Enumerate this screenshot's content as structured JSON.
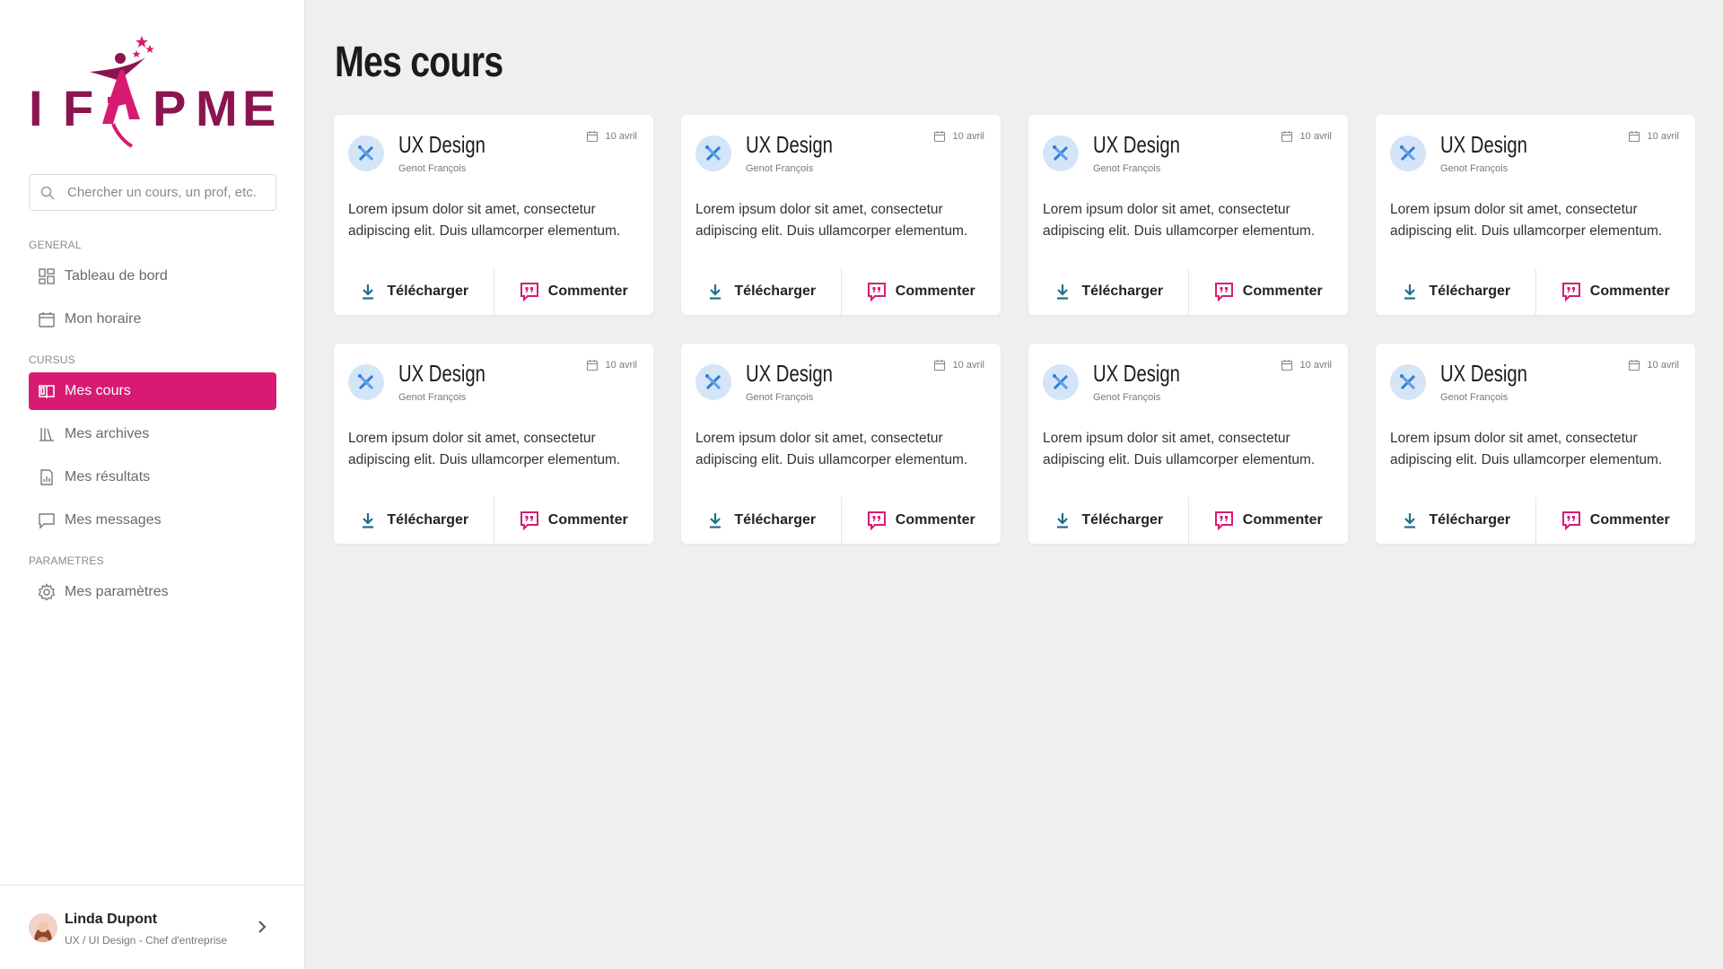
{
  "sidebar": {
    "logo_text": "IFAPME",
    "search_placeholder": "Chercher un cours, un prof, etc.",
    "sections": [
      {
        "label": "GENERAL",
        "items": [
          {
            "label": "Tableau de bord",
            "icon": "dashboard-icon"
          },
          {
            "label": "Mon horaire",
            "icon": "calendar-icon"
          }
        ]
      },
      {
        "label": "CURSUS",
        "items": [
          {
            "label": "Mes cours",
            "icon": "open-book-icon",
            "active": true
          },
          {
            "label": "Mes archives",
            "icon": "library-icon"
          },
          {
            "label": "Mes résultats",
            "icon": "report-icon"
          },
          {
            "label": "Mes messages",
            "icon": "message-icon"
          }
        ]
      },
      {
        "label": "PARAMETRES",
        "items": [
          {
            "label": "Mes paramètres",
            "icon": "gear-icon"
          }
        ]
      }
    ]
  },
  "profile": {
    "name": "Linda Dupont",
    "role": "UX / UI Design - Chef d'entreprise"
  },
  "page": {
    "title": "Mes cours"
  },
  "courses": [
    {
      "title": "UX Design",
      "author": "Genot François",
      "date": "10 avril",
      "description": "Lorem ipsum dolor sit amet, consectetur adipiscing elit. Duis ullamcorper elementum.",
      "download_label": "Télécharger",
      "comment_label": "Commenter"
    },
    {
      "title": "UX Design",
      "author": "Genot François",
      "date": "10 avril",
      "description": "Lorem ipsum dolor sit amet, consectetur adipiscing elit. Duis ullamcorper elementum.",
      "download_label": "Télécharger",
      "comment_label": "Commenter"
    },
    {
      "title": "UX Design",
      "author": "Genot François",
      "date": "10 avril",
      "description": "Lorem ipsum dolor sit amet, consectetur adipiscing elit. Duis ullamcorper elementum.",
      "download_label": "Télécharger",
      "comment_label": "Commenter"
    },
    {
      "title": "UX Design",
      "author": "Genot François",
      "date": "10 avril",
      "description": "Lorem ipsum dolor sit amet, consectetur adipiscing elit. Duis ullamcorper elementum.",
      "download_label": "Télécharger",
      "comment_label": "Commenter"
    },
    {
      "title": "UX Design",
      "author": "Genot François",
      "date": "10 avril",
      "description": "Lorem ipsum dolor sit amet, consectetur adipiscing elit. Duis ullamcorper elementum.",
      "download_label": "Télécharger",
      "comment_label": "Commenter"
    },
    {
      "title": "UX Design",
      "author": "Genot François",
      "date": "10 avril",
      "description": "Lorem ipsum dolor sit amet, consectetur adipiscing elit. Duis ullamcorper elementum.",
      "download_label": "Télécharger",
      "comment_label": "Commenter"
    },
    {
      "title": "UX Design",
      "author": "Genot François",
      "date": "10 avril",
      "description": "Lorem ipsum dolor sit amet, consectetur adipiscing elit. Duis ullamcorper elementum.",
      "download_label": "Télécharger",
      "comment_label": "Commenter"
    },
    {
      "title": "UX Design",
      "author": "Genot François",
      "date": "10 avril",
      "description": "Lorem ipsum dolor sit amet, consectetur adipiscing elit. Duis ullamcorper elementum.",
      "download_label": "Télécharger",
      "comment_label": "Commenter"
    }
  ],
  "colors": {
    "brand_primary": "#d81b72",
    "brand_logo": "#8a1550",
    "accent_blue": "#2f7fd9",
    "download_icon": "#1f6e8c",
    "comment_icon": "#d81b72"
  }
}
